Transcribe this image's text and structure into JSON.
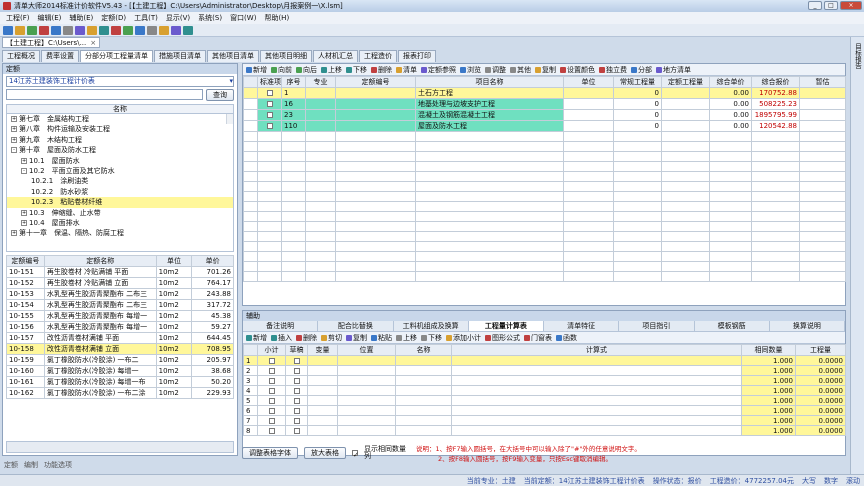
{
  "window": {
    "title": "清单大师2014标准计价软件V5.43 - [【土建工程】C:\\Users\\Administrator\\Desktop\\月报案例一\\X.lsm]",
    "min": "_",
    "max": "□",
    "close": "×"
  },
  "menu": [
    "工程(F)",
    "编辑(E)",
    "辅助(E)",
    "定额(D)",
    "工具(T)",
    "显示(V)",
    "系统(S)",
    "窗口(W)",
    "帮助(H)"
  ],
  "doc_tab": {
    "label": "【土建工程】C:\\Users\\...",
    "close": "×"
  },
  "right_rail": {
    "label": "目标报告"
  },
  "main_tabs": [
    "工程概况",
    "费率设置",
    "分部分项工程量清单",
    "措施项目清单",
    "其他项目清单",
    "其他项目明细",
    "人材机汇总",
    "工程造价",
    "报表打印"
  ],
  "left": {
    "panel_title": "定额",
    "library": "14江苏土建装饰工程计价表",
    "query_button": "查询",
    "tree_header": "名称",
    "tree": [
      {
        "toggle": "+",
        "text": "第七章　金属结构工程",
        "indent": 0,
        "sel": false
      },
      {
        "toggle": "+",
        "text": "第八章　构件运输及安装工程",
        "indent": 0,
        "sel": false
      },
      {
        "toggle": "+",
        "text": "第九章　木结构工程",
        "indent": 0,
        "sel": false
      },
      {
        "toggle": "-",
        "text": "第十章　屋面及防水工程",
        "indent": 0,
        "sel": false
      },
      {
        "toggle": "+",
        "text": "10.1　屋面防水",
        "indent": 1,
        "sel": false
      },
      {
        "toggle": "-",
        "text": "10.2　平面立面及其它防水",
        "indent": 1,
        "sel": false
      },
      {
        "toggle": "",
        "text": "10.2.1　涂刷油类",
        "indent": 2,
        "sel": false
      },
      {
        "toggle": "",
        "text": "10.2.2　防水砂浆",
        "indent": 2,
        "sel": false
      },
      {
        "toggle": "",
        "text": "10.2.3　粘贴卷材纤维",
        "indent": 2,
        "sel": true
      },
      {
        "toggle": "+",
        "text": "10.3　伸缩缝、止水带",
        "indent": 1,
        "sel": false
      },
      {
        "toggle": "+",
        "text": "10.4　屋面排水",
        "indent": 1,
        "sel": false
      },
      {
        "toggle": "+",
        "text": "第十一章　保温、隔热、防腐工程",
        "indent": 0,
        "sel": false
      }
    ],
    "quota_headers": [
      "定额编号",
      "定额名称",
      "单位",
      "单价"
    ],
    "quota_rows": [
      {
        "code": "10-151",
        "name": "再生胶卷材 冷贴满铺 平面",
        "unit": "10m2",
        "price": "701.26",
        "sel": false
      },
      {
        "code": "10-152",
        "name": "再生胶卷材 冷贴满铺 立面",
        "unit": "10m2",
        "price": "764.17",
        "sel": false
      },
      {
        "code": "10-153",
        "name": "水乳型再生胶沥青聚酯布 二布三",
        "unit": "10m2",
        "price": "243.88",
        "sel": false
      },
      {
        "code": "10-154",
        "name": "水乳型再生胶沥青聚酯布 二布三",
        "unit": "10m2",
        "price": "317.72",
        "sel": false
      },
      {
        "code": "10-155",
        "name": "水乳型再生胶沥青聚酯布 每增一",
        "unit": "10m2",
        "price": "45.38",
        "sel": false
      },
      {
        "code": "10-156",
        "name": "水乳型再生胶沥青聚酯布 每增一",
        "unit": "10m2",
        "price": "59.27",
        "sel": false
      },
      {
        "code": "10-157",
        "name": "改性沥青卷材满铺 平面",
        "unit": "10m2",
        "price": "644.45",
        "sel": false
      },
      {
        "code": "10-158",
        "name": "改性沥青卷材满铺 立面",
        "unit": "10m2",
        "price": "708.95",
        "sel": true
      },
      {
        "code": "10-159",
        "name": "氯丁橡胶防水(冷胶涂) 一布二",
        "unit": "10m2",
        "price": "205.97",
        "sel": false
      },
      {
        "code": "10-160",
        "name": "氯丁橡胶防水(冷胶涂) 每增一",
        "unit": "10m2",
        "price": "38.68",
        "sel": false
      },
      {
        "code": "10-161",
        "name": "氯丁橡胶防水(冷胶涂) 每增一布",
        "unit": "10m2",
        "price": "50.20",
        "sel": false
      },
      {
        "code": "10-162",
        "name": "氯丁橡胶防水(冷胶涂) 一布二涂",
        "unit": "10m2",
        "price": "229.93",
        "sel": false
      }
    ],
    "bottom_labels": [
      "定额",
      "编制",
      "功能选项"
    ]
  },
  "main_toolbar": [
    "新增",
    "向前",
    "向后",
    "上移",
    "下移",
    "删除",
    "清单",
    "定额参照",
    "浏览",
    "调整",
    "其他",
    "复制",
    "设置颜色",
    "独立费",
    "分部",
    "地方清单"
  ],
  "grid": {
    "headers": [
      "",
      "标准项",
      "序号",
      "专业",
      "定额编号",
      "项目名称",
      "单位",
      "常规工程量",
      "定额工程量",
      "综合单价",
      "综合报价",
      "暂估"
    ],
    "rows": [
      {
        "no": "1",
        "code": "",
        "name": "土石方工程",
        "unit": "",
        "qty": "0",
        "dqty": "",
        "uprice": "0.00",
        "total": "170752.88",
        "style": "yellow"
      },
      {
        "no": "16",
        "code": "",
        "name": "地基处理与边坡支护工程",
        "unit": "",
        "qty": "0",
        "dqty": "",
        "uprice": "0.00",
        "total": "508225.23",
        "style": "green"
      },
      {
        "no": "23",
        "code": "",
        "name": "混凝土及钢筋混凝土工程",
        "unit": "",
        "qty": "0",
        "dqty": "",
        "uprice": "0.00",
        "total": "1895795.99",
        "style": "green"
      },
      {
        "no": "110",
        "code": "",
        "name": "屋面及防水工程",
        "unit": "",
        "qty": "0",
        "dqty": "",
        "uprice": "0.00",
        "total": "120542.88",
        "style": "green"
      }
    ]
  },
  "aux": {
    "title": "辅助",
    "tabs": [
      "备注说明",
      "配合比替换",
      "工料机组成及换算",
      "工程量计算表",
      "清单特征",
      "项目指引",
      "模板钢筋",
      "换算说明"
    ],
    "active_tab": 3,
    "toolbar": [
      "新增",
      "插入",
      "删除",
      "剪切",
      "复制",
      "粘贴",
      "上移",
      "下移",
      "添加小计",
      "图形公式",
      "门窗表",
      "函数"
    ],
    "headers": [
      "",
      "小计",
      "草稿",
      "变量",
      "位置",
      "名称",
      "计算式",
      "相同数量",
      "工程量"
    ],
    "rows": [
      {
        "no": "1",
        "same": "1.000",
        "qty": "0.0000"
      },
      {
        "no": "2",
        "same": "1.000",
        "qty": "0.0000"
      },
      {
        "no": "3",
        "same": "1.000",
        "qty": "0.0000"
      },
      {
        "no": "4",
        "same": "1.000",
        "qty": "0.0000"
      },
      {
        "no": "5",
        "same": "1.000",
        "qty": "0.0000"
      },
      {
        "no": "6",
        "same": "1.000",
        "qty": "0.0000"
      },
      {
        "no": "7",
        "same": "1.000",
        "qty": "0.0000"
      },
      {
        "no": "8",
        "same": "1.000",
        "qty": "0.0000"
      }
    ],
    "btn_font": "调整表格字体",
    "btn_enlarge": "放大表格",
    "show_same_qty": "显示相同数量列",
    "hint1": "说明：1、按F7输入圆括号，在大括号中可以输入除了\"#\"外的任意说明文字。",
    "hint2": "2、按F8输入圆括号，按F9输入变量，只按Esc键取消编辑。"
  },
  "status": [
    "当前专业：土建",
    "当前定额：14江苏土建装饰工程计价表",
    "操作状态：报价",
    "工程造价：4772257.04元",
    "大写",
    "数字",
    "滚动"
  ]
}
